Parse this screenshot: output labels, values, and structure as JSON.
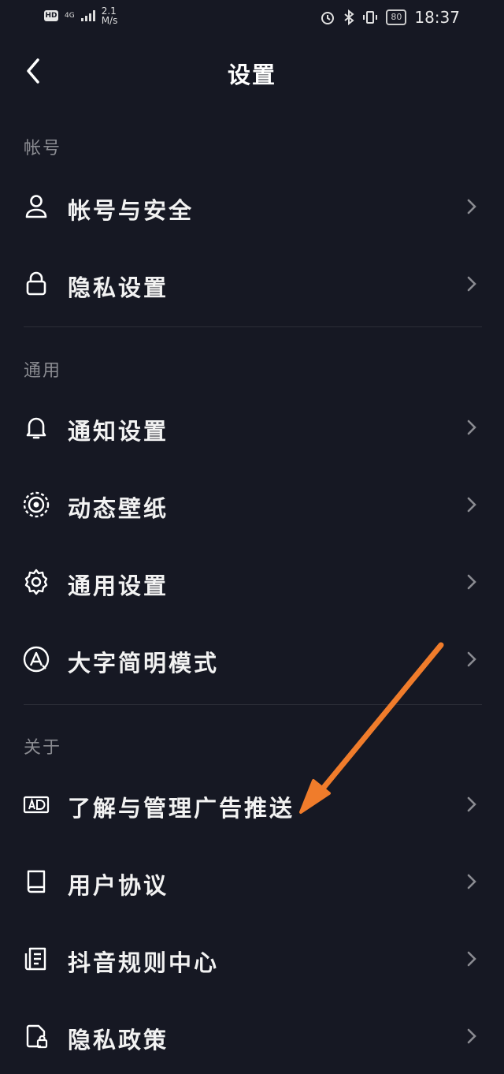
{
  "status_bar": {
    "hd": "HD",
    "network": "4G",
    "speed_value": "2.1",
    "speed_unit": "M/s",
    "battery": "80",
    "time": "18:37"
  },
  "header": {
    "title": "设置"
  },
  "sections": [
    {
      "label": "帐号",
      "items": [
        {
          "label": "帐号与安全",
          "icon": "user-icon"
        },
        {
          "label": "隐私设置",
          "icon": "lock-icon"
        }
      ]
    },
    {
      "label": "通用",
      "items": [
        {
          "label": "通知设置",
          "icon": "bell-icon"
        },
        {
          "label": "动态壁纸",
          "icon": "live-wallpaper-icon"
        },
        {
          "label": "通用设置",
          "icon": "gear-icon"
        },
        {
          "label": "大字简明模式",
          "icon": "large-font-icon"
        }
      ]
    },
    {
      "label": "关于",
      "items": [
        {
          "label": "了解与管理广告推送",
          "icon": "ad-icon"
        },
        {
          "label": "用户协议",
          "icon": "book-icon"
        },
        {
          "label": "抖音规则中心",
          "icon": "document-list-icon"
        },
        {
          "label": "隐私政策",
          "icon": "privacy-policy-icon"
        }
      ]
    }
  ],
  "colors": {
    "background": "#161823",
    "text": "#f2f2f2",
    "section_label": "#8a8b91",
    "annotation_arrow": "#f07c2b"
  }
}
